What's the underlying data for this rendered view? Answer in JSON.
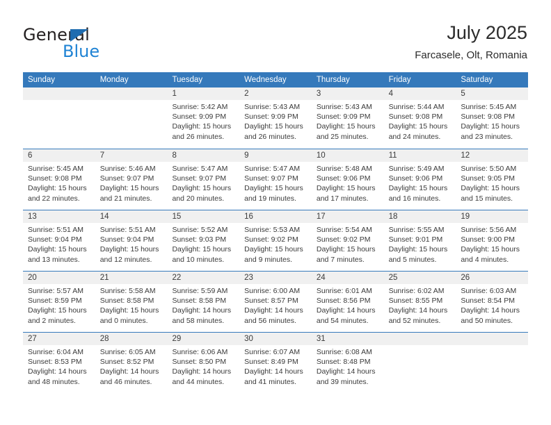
{
  "brand": {
    "name_part1": "General",
    "name_part2": "Blue",
    "triangle_color": "#1f6cb0",
    "blue_color": "#1f83d4"
  },
  "header": {
    "title": "July 2025",
    "subtitle": "Farcasele, Olt, Romania"
  },
  "theme": {
    "header_bar_color": "#3579bb",
    "day_band_color": "#f0f0f0",
    "text_color": "#3a3a3a"
  },
  "weekdays": [
    "Sunday",
    "Monday",
    "Tuesday",
    "Wednesday",
    "Thursday",
    "Friday",
    "Saturday"
  ],
  "weeks": [
    {
      "days": [
        {
          "number": "",
          "empty": true,
          "sunrise": "",
          "sunset": "",
          "daylight_line1": "",
          "daylight_line2": ""
        },
        {
          "number": "",
          "empty": true,
          "sunrise": "",
          "sunset": "",
          "daylight_line1": "",
          "daylight_line2": ""
        },
        {
          "number": "1",
          "empty": false,
          "sunrise": "Sunrise: 5:42 AM",
          "sunset": "Sunset: 9:09 PM",
          "daylight_line1": "Daylight: 15 hours",
          "daylight_line2": "and 26 minutes."
        },
        {
          "number": "2",
          "empty": false,
          "sunrise": "Sunrise: 5:43 AM",
          "sunset": "Sunset: 9:09 PM",
          "daylight_line1": "Daylight: 15 hours",
          "daylight_line2": "and 26 minutes."
        },
        {
          "number": "3",
          "empty": false,
          "sunrise": "Sunrise: 5:43 AM",
          "sunset": "Sunset: 9:09 PM",
          "daylight_line1": "Daylight: 15 hours",
          "daylight_line2": "and 25 minutes."
        },
        {
          "number": "4",
          "empty": false,
          "sunrise": "Sunrise: 5:44 AM",
          "sunset": "Sunset: 9:08 PM",
          "daylight_line1": "Daylight: 15 hours",
          "daylight_line2": "and 24 minutes."
        },
        {
          "number": "5",
          "empty": false,
          "sunrise": "Sunrise: 5:45 AM",
          "sunset": "Sunset: 9:08 PM",
          "daylight_line1": "Daylight: 15 hours",
          "daylight_line2": "and 23 minutes."
        }
      ]
    },
    {
      "days": [
        {
          "number": "6",
          "empty": false,
          "sunrise": "Sunrise: 5:45 AM",
          "sunset": "Sunset: 9:08 PM",
          "daylight_line1": "Daylight: 15 hours",
          "daylight_line2": "and 22 minutes."
        },
        {
          "number": "7",
          "empty": false,
          "sunrise": "Sunrise: 5:46 AM",
          "sunset": "Sunset: 9:07 PM",
          "daylight_line1": "Daylight: 15 hours",
          "daylight_line2": "and 21 minutes."
        },
        {
          "number": "8",
          "empty": false,
          "sunrise": "Sunrise: 5:47 AM",
          "sunset": "Sunset: 9:07 PM",
          "daylight_line1": "Daylight: 15 hours",
          "daylight_line2": "and 20 minutes."
        },
        {
          "number": "9",
          "empty": false,
          "sunrise": "Sunrise: 5:47 AM",
          "sunset": "Sunset: 9:07 PM",
          "daylight_line1": "Daylight: 15 hours",
          "daylight_line2": "and 19 minutes."
        },
        {
          "number": "10",
          "empty": false,
          "sunrise": "Sunrise: 5:48 AM",
          "sunset": "Sunset: 9:06 PM",
          "daylight_line1": "Daylight: 15 hours",
          "daylight_line2": "and 17 minutes."
        },
        {
          "number": "11",
          "empty": false,
          "sunrise": "Sunrise: 5:49 AM",
          "sunset": "Sunset: 9:06 PM",
          "daylight_line1": "Daylight: 15 hours",
          "daylight_line2": "and 16 minutes."
        },
        {
          "number": "12",
          "empty": false,
          "sunrise": "Sunrise: 5:50 AM",
          "sunset": "Sunset: 9:05 PM",
          "daylight_line1": "Daylight: 15 hours",
          "daylight_line2": "and 15 minutes."
        }
      ]
    },
    {
      "days": [
        {
          "number": "13",
          "empty": false,
          "sunrise": "Sunrise: 5:51 AM",
          "sunset": "Sunset: 9:04 PM",
          "daylight_line1": "Daylight: 15 hours",
          "daylight_line2": "and 13 minutes."
        },
        {
          "number": "14",
          "empty": false,
          "sunrise": "Sunrise: 5:51 AM",
          "sunset": "Sunset: 9:04 PM",
          "daylight_line1": "Daylight: 15 hours",
          "daylight_line2": "and 12 minutes."
        },
        {
          "number": "15",
          "empty": false,
          "sunrise": "Sunrise: 5:52 AM",
          "sunset": "Sunset: 9:03 PM",
          "daylight_line1": "Daylight: 15 hours",
          "daylight_line2": "and 10 minutes."
        },
        {
          "number": "16",
          "empty": false,
          "sunrise": "Sunrise: 5:53 AM",
          "sunset": "Sunset: 9:02 PM",
          "daylight_line1": "Daylight: 15 hours",
          "daylight_line2": "and 9 minutes."
        },
        {
          "number": "17",
          "empty": false,
          "sunrise": "Sunrise: 5:54 AM",
          "sunset": "Sunset: 9:02 PM",
          "daylight_line1": "Daylight: 15 hours",
          "daylight_line2": "and 7 minutes."
        },
        {
          "number": "18",
          "empty": false,
          "sunrise": "Sunrise: 5:55 AM",
          "sunset": "Sunset: 9:01 PM",
          "daylight_line1": "Daylight: 15 hours",
          "daylight_line2": "and 5 minutes."
        },
        {
          "number": "19",
          "empty": false,
          "sunrise": "Sunrise: 5:56 AM",
          "sunset": "Sunset: 9:00 PM",
          "daylight_line1": "Daylight: 15 hours",
          "daylight_line2": "and 4 minutes."
        }
      ]
    },
    {
      "days": [
        {
          "number": "20",
          "empty": false,
          "sunrise": "Sunrise: 5:57 AM",
          "sunset": "Sunset: 8:59 PM",
          "daylight_line1": "Daylight: 15 hours",
          "daylight_line2": "and 2 minutes."
        },
        {
          "number": "21",
          "empty": false,
          "sunrise": "Sunrise: 5:58 AM",
          "sunset": "Sunset: 8:58 PM",
          "daylight_line1": "Daylight: 15 hours",
          "daylight_line2": "and 0 minutes."
        },
        {
          "number": "22",
          "empty": false,
          "sunrise": "Sunrise: 5:59 AM",
          "sunset": "Sunset: 8:58 PM",
          "daylight_line1": "Daylight: 14 hours",
          "daylight_line2": "and 58 minutes."
        },
        {
          "number": "23",
          "empty": false,
          "sunrise": "Sunrise: 6:00 AM",
          "sunset": "Sunset: 8:57 PM",
          "daylight_line1": "Daylight: 14 hours",
          "daylight_line2": "and 56 minutes."
        },
        {
          "number": "24",
          "empty": false,
          "sunrise": "Sunrise: 6:01 AM",
          "sunset": "Sunset: 8:56 PM",
          "daylight_line1": "Daylight: 14 hours",
          "daylight_line2": "and 54 minutes."
        },
        {
          "number": "25",
          "empty": false,
          "sunrise": "Sunrise: 6:02 AM",
          "sunset": "Sunset: 8:55 PM",
          "daylight_line1": "Daylight: 14 hours",
          "daylight_line2": "and 52 minutes."
        },
        {
          "number": "26",
          "empty": false,
          "sunrise": "Sunrise: 6:03 AM",
          "sunset": "Sunset: 8:54 PM",
          "daylight_line1": "Daylight: 14 hours",
          "daylight_line2": "and 50 minutes."
        }
      ]
    },
    {
      "days": [
        {
          "number": "27",
          "empty": false,
          "sunrise": "Sunrise: 6:04 AM",
          "sunset": "Sunset: 8:53 PM",
          "daylight_line1": "Daylight: 14 hours",
          "daylight_line2": "and 48 minutes."
        },
        {
          "number": "28",
          "empty": false,
          "sunrise": "Sunrise: 6:05 AM",
          "sunset": "Sunset: 8:52 PM",
          "daylight_line1": "Daylight: 14 hours",
          "daylight_line2": "and 46 minutes."
        },
        {
          "number": "29",
          "empty": false,
          "sunrise": "Sunrise: 6:06 AM",
          "sunset": "Sunset: 8:50 PM",
          "daylight_line1": "Daylight: 14 hours",
          "daylight_line2": "and 44 minutes."
        },
        {
          "number": "30",
          "empty": false,
          "sunrise": "Sunrise: 6:07 AM",
          "sunset": "Sunset: 8:49 PM",
          "daylight_line1": "Daylight: 14 hours",
          "daylight_line2": "and 41 minutes."
        },
        {
          "number": "31",
          "empty": false,
          "sunrise": "Sunrise: 6:08 AM",
          "sunset": "Sunset: 8:48 PM",
          "daylight_line1": "Daylight: 14 hours",
          "daylight_line2": "and 39 minutes."
        },
        {
          "number": "",
          "empty": true,
          "sunrise": "",
          "sunset": "",
          "daylight_line1": "",
          "daylight_line2": ""
        },
        {
          "number": "",
          "empty": true,
          "sunrise": "",
          "sunset": "",
          "daylight_line1": "",
          "daylight_line2": ""
        }
      ]
    }
  ]
}
